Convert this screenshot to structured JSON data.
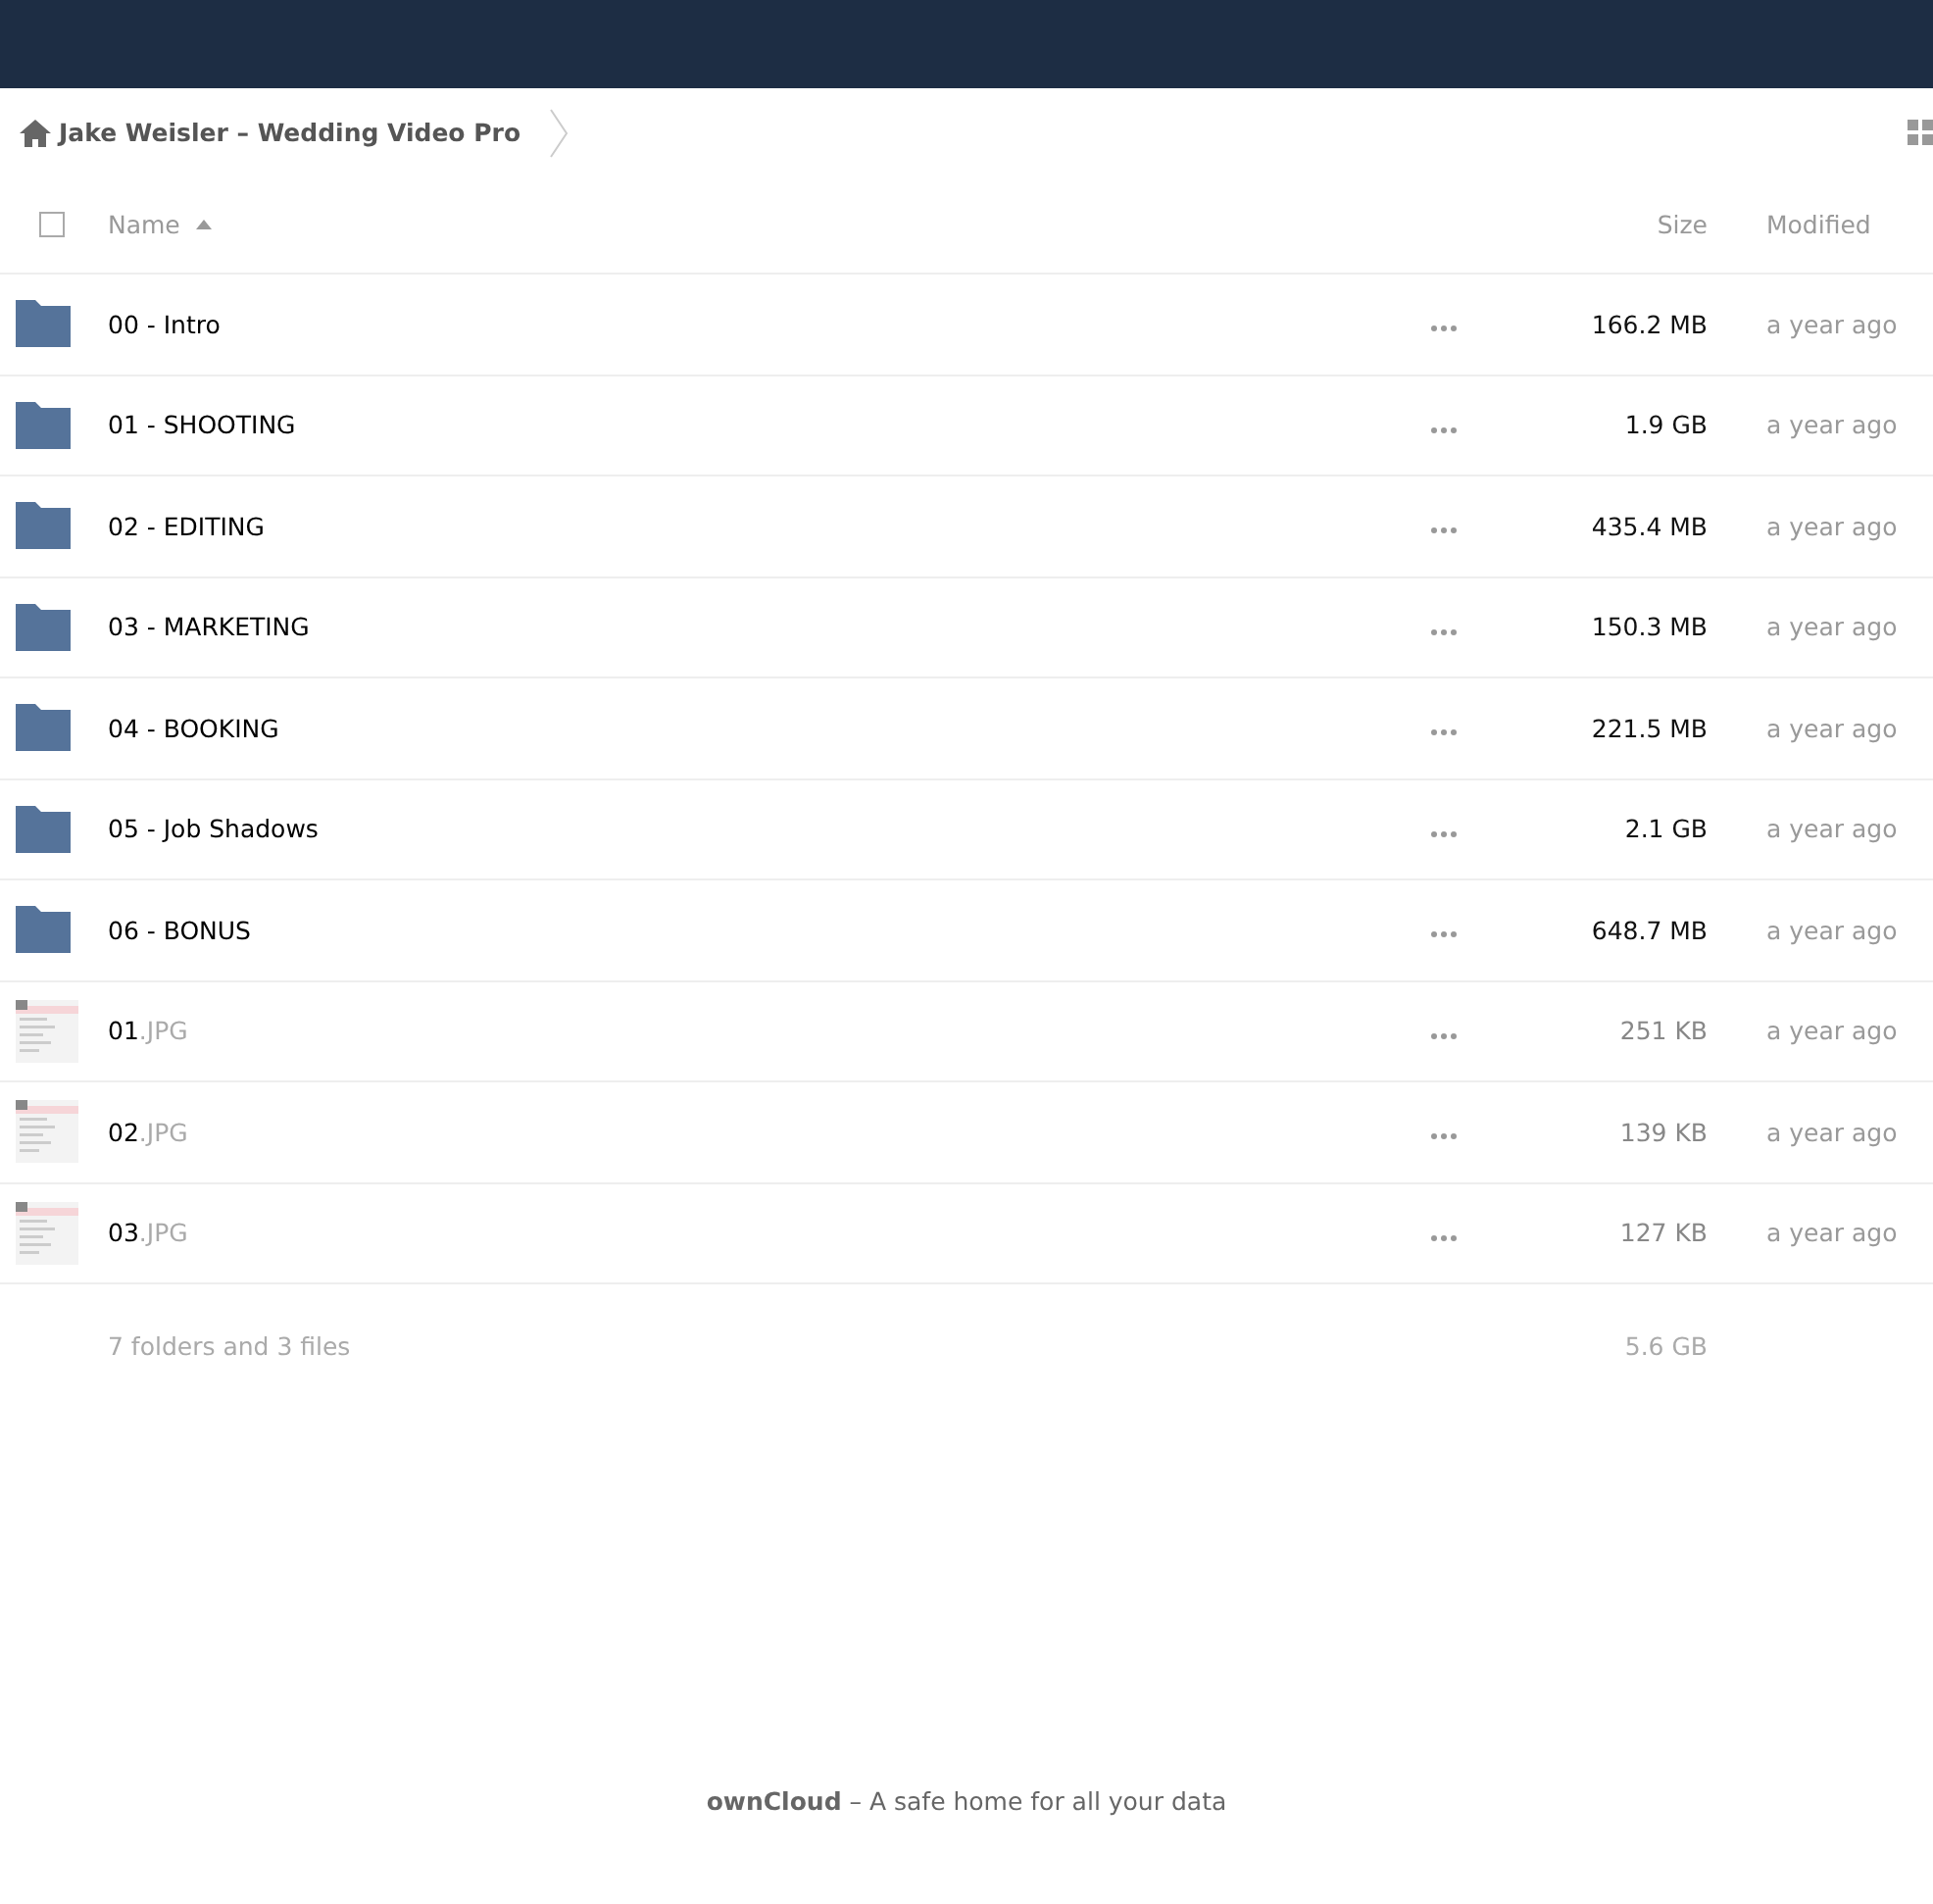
{
  "breadcrumb": {
    "title": "Jake Weisler – Wedding Video Pro"
  },
  "table": {
    "columns": {
      "name": "Name",
      "size": "Size",
      "modified": "Modified"
    },
    "select_all": {
      "checked": false
    },
    "rows": [
      {
        "kind": "folder",
        "name": "00 - Intro",
        "size": "166.2 MB",
        "modified": "a year ago"
      },
      {
        "kind": "folder",
        "name": "01 - SHOOTING",
        "size": "1.9 GB",
        "modified": "a year ago"
      },
      {
        "kind": "folder",
        "name": "02 - EDITING",
        "size": "435.4 MB",
        "modified": "a year ago"
      },
      {
        "kind": "folder",
        "name": "03 - MARKETING",
        "size": "150.3 MB",
        "modified": "a year ago"
      },
      {
        "kind": "folder",
        "name": "04 - BOOKING",
        "size": "221.5 MB",
        "modified": "a year ago"
      },
      {
        "kind": "folder",
        "name": "05 - Job Shadows",
        "size": "2.1 GB",
        "modified": "a year ago"
      },
      {
        "kind": "folder",
        "name": "06 - BONUS",
        "size": "648.7 MB",
        "modified": "a year ago"
      },
      {
        "kind": "file",
        "name": "01",
        "extension": ".JPG",
        "size": "251 KB",
        "modified": "a year ago"
      },
      {
        "kind": "file",
        "name": "02",
        "extension": ".JPG",
        "size": "139 KB",
        "modified": "a year ago"
      },
      {
        "kind": "file",
        "name": "03",
        "extension": ".JPG",
        "size": "127 KB",
        "modified": "a year ago"
      }
    ],
    "summary": {
      "count": "7 folders and 3 files",
      "size": "5.6 GB"
    }
  },
  "footer": "**ownCloud** – A safe home for all your data"
}
